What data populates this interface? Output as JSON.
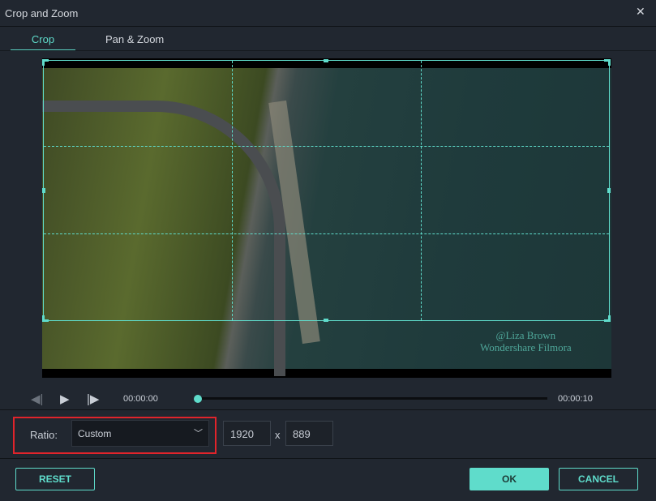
{
  "window": {
    "title": "Crop and Zoom",
    "close_icon": "close-icon"
  },
  "tabs": [
    {
      "label": "Crop",
      "active": true
    },
    {
      "label": "Pan & Zoom",
      "active": false
    }
  ],
  "preview": {
    "watermark": [
      "@Liza Brown",
      "Wondershare Filmora"
    ]
  },
  "playback": {
    "current_time": "00:00:00",
    "end_time": "00:00:10",
    "progress": 0
  },
  "ratio": {
    "label": "Ratio:",
    "selected": "Custom",
    "width": "1920",
    "separator": "x",
    "height": "889"
  },
  "buttons": {
    "reset": "RESET",
    "ok": "OK",
    "cancel": "CANCEL"
  },
  "colors": {
    "accent": "#5fdccb",
    "highlight": "#e0242b",
    "background": "#212730"
  }
}
